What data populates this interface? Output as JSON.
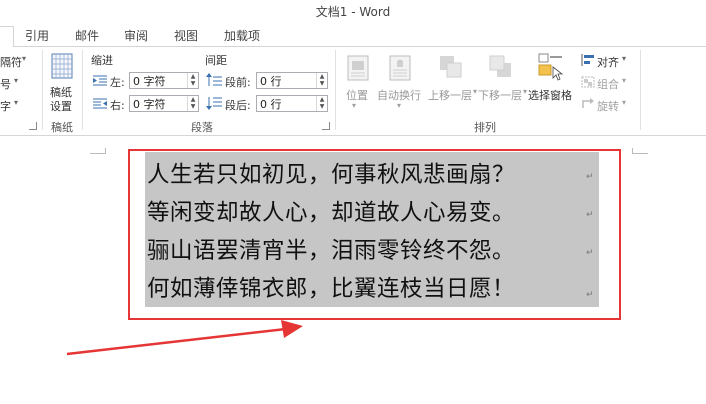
{
  "window": {
    "title": "文档1 - Word"
  },
  "tabs": [
    {
      "label": "引用"
    },
    {
      "label": "邮件"
    },
    {
      "label": "审阅"
    },
    {
      "label": "视图"
    },
    {
      "label": "加载项"
    }
  ],
  "ribbon": {
    "left_partial": {
      "row1": "隔符",
      "row2": "号",
      "row3": "字"
    },
    "gaozhi": {
      "button_line1": "稿纸",
      "button_line2": "设置",
      "group": "稿纸"
    },
    "paragraph": {
      "indent_header": "缩进",
      "spacing_header": "间距",
      "left_label": "左:",
      "left_value": "0 字符",
      "right_label": "右:",
      "right_value": "0 字符",
      "before_label": "段前:",
      "before_value": "0 行",
      "after_label": "段后:",
      "after_value": "0 行",
      "group": "段落"
    },
    "arrange": {
      "position": "位置",
      "wrap_text": "自动换行",
      "bring_forward": "上移一层",
      "send_backward": "下移一层",
      "selection_pane": "选择窗格",
      "align": "对齐",
      "group_btn": "组合",
      "rotate": "旋转",
      "group": "排列"
    }
  },
  "document": {
    "lines": [
      "人生若只如初见，何事秋风悲画扇？",
      "等闲变却故人心，却道故人心易变。",
      "骊山语罢清宵半，泪雨零铃终不怨。",
      "何如薄倖锦衣郎，比翼连枝当日愿！"
    ],
    "paragraph_mark": "↵"
  },
  "annotation": {
    "box_color": "#e53535",
    "arrow_color": "#e53535"
  }
}
